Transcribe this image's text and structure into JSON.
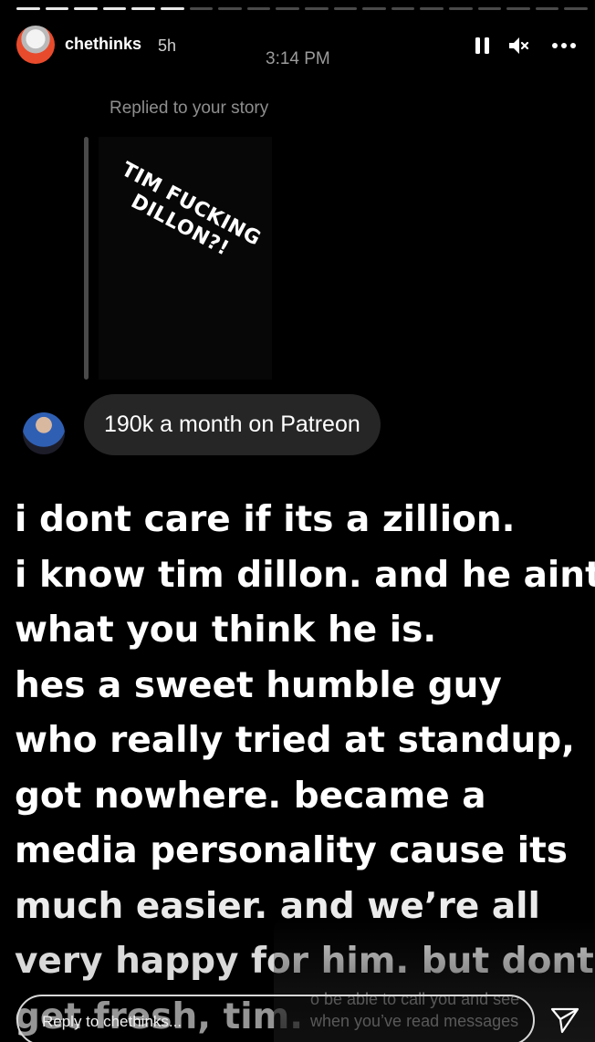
{
  "progress": {
    "total_segments": 20,
    "completed_segments": 6
  },
  "header": {
    "username": "chethinks",
    "time_ago": "5h",
    "clock": "3:14 PM",
    "icons": [
      "pause-icon",
      "mute-icon",
      "more-icon"
    ]
  },
  "reply_context": {
    "label": "Replied to your story",
    "story_text": "TIM FUCKING DILLON?!"
  },
  "message": {
    "text": "190k a month on Patreon"
  },
  "story_body": {
    "lines": [
      "i dont care if its a zillion.",
      "i know tim dillon. and he aint",
      "what you think he is.",
      "hes a sweet humble guy",
      "who really tried at standup,",
      "got nowhere. became a",
      "media personality cause its",
      "much easier. and we’re all",
      "very happy for him. but dont",
      "get fresh, tim."
    ]
  },
  "overlay_notice": {
    "line1": "o be able to call you and see",
    "line2": "when you’ve read messages"
  },
  "reply_bar": {
    "placeholder": "Reply to chethinks..."
  },
  "colors": {
    "background": "#000000",
    "bubble": "#262626",
    "muted_text": "#8e8e8e"
  }
}
